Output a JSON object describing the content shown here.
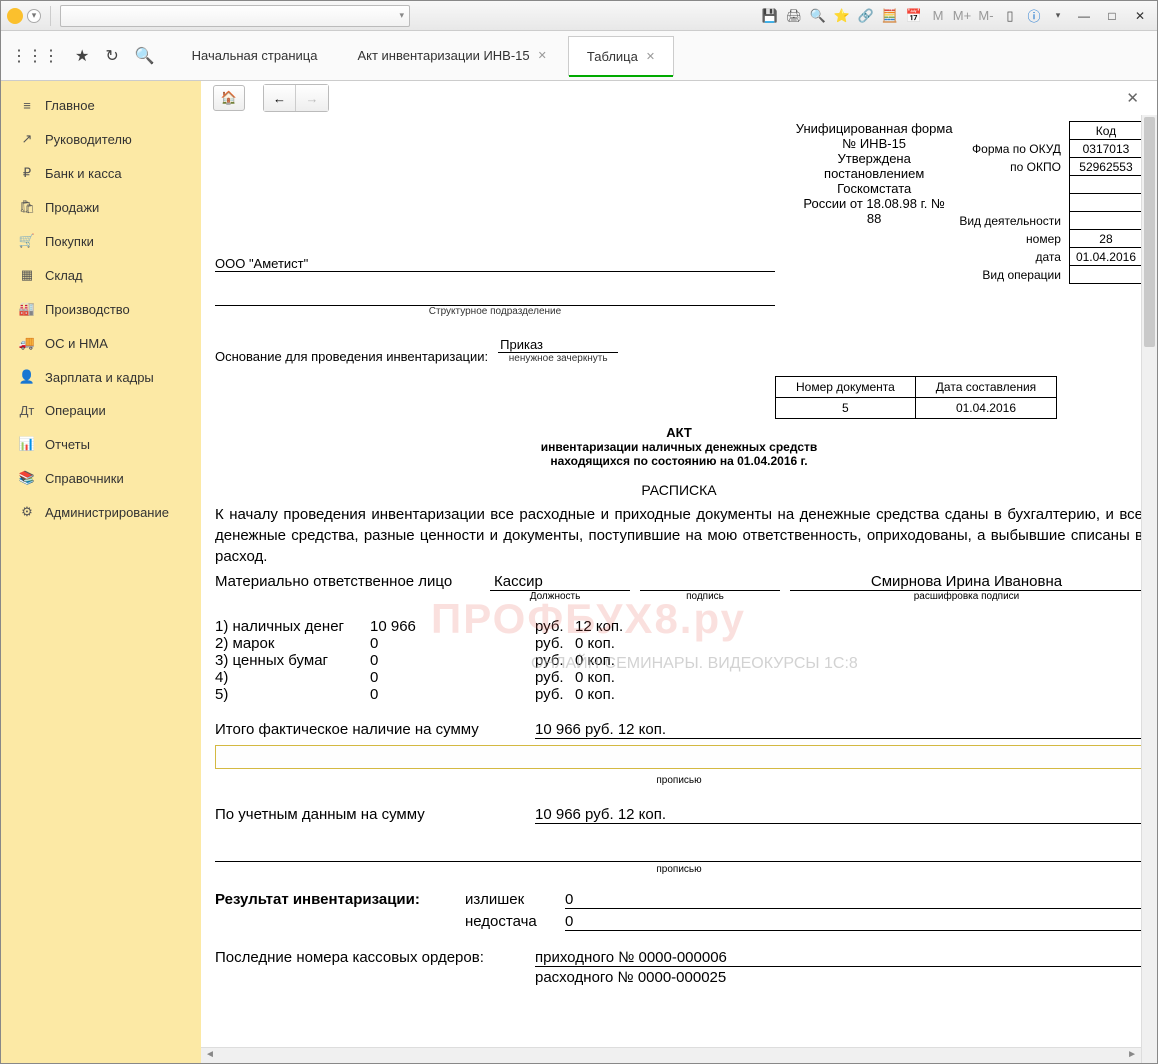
{
  "tabs": [
    {
      "label": "Начальная страница",
      "closable": false
    },
    {
      "label": "Акт инвентаризации ИНВ-15",
      "closable": true
    },
    {
      "label": "Таблица",
      "closable": true,
      "active": true
    }
  ],
  "sidebar": [
    {
      "icon": "≡",
      "label": "Главное"
    },
    {
      "icon": "↗",
      "label": "Руководителю"
    },
    {
      "icon": "₽",
      "label": "Банк и касса"
    },
    {
      "icon": "🛍",
      "label": "Продажи"
    },
    {
      "icon": "🛒",
      "label": "Покупки"
    },
    {
      "icon": "▦",
      "label": "Склад"
    },
    {
      "icon": "🏭",
      "label": "Производство"
    },
    {
      "icon": "🚚",
      "label": "ОС и НМА"
    },
    {
      "icon": "👤",
      "label": "Зарплата и кадры"
    },
    {
      "icon": "Дт",
      "label": "Операции"
    },
    {
      "icon": "📊",
      "label": "Отчеты"
    },
    {
      "icon": "📚",
      "label": "Справочники"
    },
    {
      "icon": "⚙",
      "label": "Администрирование"
    }
  ],
  "doc": {
    "form_title1": "Унифицированная форма № ИНВ-15",
    "form_title2": "Утверждена постановлением Госкомстата",
    "form_title3": "России от 18.08.98 г. № 88",
    "code_header": "Код",
    "okud_label": "Форма по ОКУД",
    "okud": "0317013",
    "okpo_label": "по ОКПО",
    "okpo": "52962553",
    "activity_label": "Вид деятельности",
    "number_label": "номер",
    "number": "28",
    "date_label": "дата",
    "date": "01.04.2016",
    "operation_label": "Вид операции",
    "org": "ООО \"Аметист\"",
    "subdiv_label": "Структурное подразделение",
    "basis_label": "Основание для проведения инвентаризации:",
    "basis_value": "Приказ",
    "basis_sub": "ненужное зачеркнуть",
    "doc_num_hdr": "Номер документа",
    "doc_date_hdr": "Дата составления",
    "doc_num": "5",
    "doc_date": "01.04.2016",
    "act": "АКТ",
    "act_line1": "инвентаризации наличных денежных средств",
    "act_line2": "находящихся по состоянию на 01.04.2016 г.",
    "receipt": "РАСПИСКА",
    "body": "К началу проведения инвентаризации все расходные и приходные документы на денежные средства сданы в бухгалтерию, и все денежные средства, разные ценности и документы, поступившие на мою ответственность, оприходованы, а выбывшие списаны в расход.",
    "resp_label": "Материально ответственное лицо",
    "resp_pos": "Кассир",
    "resp_pos_sub": "Должность",
    "resp_sign_sub": "подпись",
    "resp_name": "Смирнова Ирина Ивановна",
    "resp_name_sub": "расшифровка подписи",
    "items": [
      {
        "n": "1) наличных денег",
        "amount": "10 966",
        "rub": "руб.",
        "kop": "12 коп."
      },
      {
        "n": "2) марок",
        "amount": "0",
        "rub": "руб.",
        "kop": "0 коп."
      },
      {
        "n": "3) ценных бумаг",
        "amount": "0",
        "rub": "руб.",
        "kop": "0 коп."
      },
      {
        "n": "4)",
        "amount": "0",
        "rub": "руб.",
        "kop": "0 коп."
      },
      {
        "n": "5)",
        "amount": "0",
        "rub": "руб.",
        "kop": "0 коп."
      }
    ],
    "total_label": "Итого фактическое наличие на сумму",
    "total_value": "10 966 руб. 12 коп.",
    "words_sub": "прописью",
    "account_label": "По учетным данным на сумму",
    "account_value": "10 966 руб. 12 коп.",
    "result_label": "Результат инвентаризации:",
    "surplus_label": "излишек",
    "surplus_value": "0",
    "shortage_label": "недостача",
    "shortage_value": "0",
    "last_orders": "Последние номера кассовых ордеров:",
    "in_order": "приходного № 0000-000006",
    "out_order": "расходного № 0000-000025"
  },
  "watermark": "ПРОФБУХ8.ру",
  "watermark2": "ОНЛАЙН-СЕМИНАРЫ. ВИДЕОКУРСЫ 1С:8"
}
